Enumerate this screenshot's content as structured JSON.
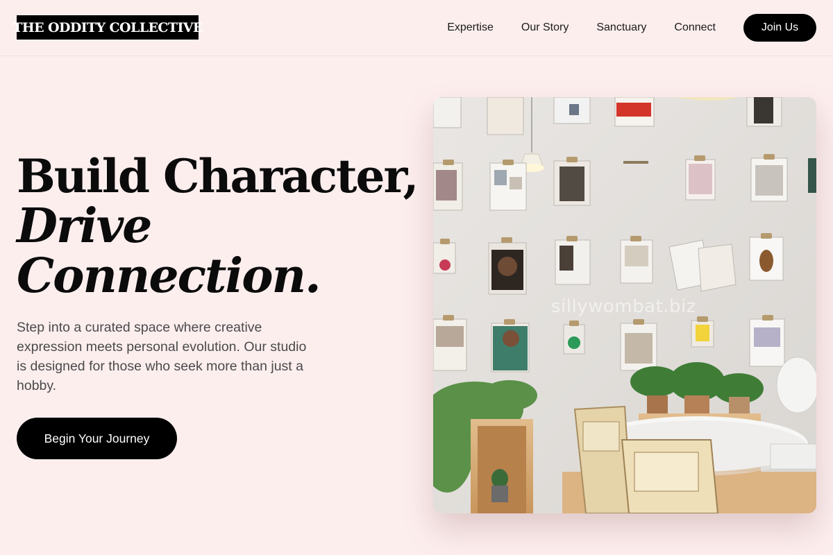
{
  "header": {
    "logo_text": "THE ODDITY COLLECTIVE",
    "nav": [
      {
        "label": "Expertise"
      },
      {
        "label": "Our Story"
      },
      {
        "label": "Sanctuary"
      },
      {
        "label": "Connect"
      }
    ],
    "join_label": "Join Us"
  },
  "hero": {
    "title_line1": "Build Character,",
    "title_line2": "Drive",
    "title_line3": "Connection.",
    "description": "Step into a curated space where creative expression meets personal evolution. Our studio is designed for those who seek more than just a hobby.",
    "cta_label": "Begin Your Journey",
    "image_watermark": "sillywombat.biz"
  },
  "colors": {
    "background": "#fdeeee",
    "primary": "#000000",
    "text": "#111111",
    "muted_text": "#4a4a4a"
  }
}
